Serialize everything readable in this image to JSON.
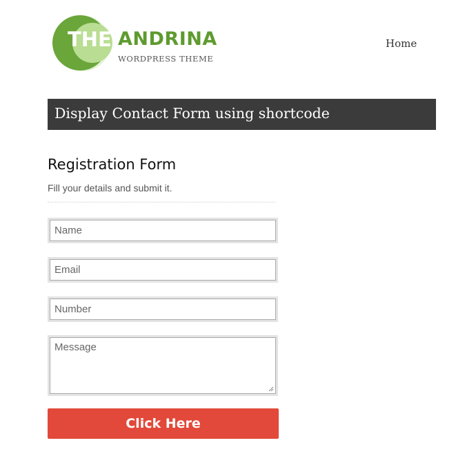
{
  "site": {
    "logo_the": "THE",
    "logo_name": "ANDRINA",
    "logo_subtitle": "WORDPRESS THEME",
    "colors": {
      "logo_green": "#5e9b2f",
      "logo_light_green": "#d4ebbe",
      "title_bar": "#3b3b3b",
      "button": "#e2493a"
    }
  },
  "nav": {
    "home_label": "Home"
  },
  "page": {
    "title": "Display Contact Form using shortcode"
  },
  "form": {
    "heading": "Registration Form",
    "description": "Fill your details and submit it.",
    "name_placeholder": "Name",
    "email_placeholder": "Email",
    "number_placeholder": "Number",
    "message_placeholder": "Message",
    "submit_label": "Click Here"
  }
}
